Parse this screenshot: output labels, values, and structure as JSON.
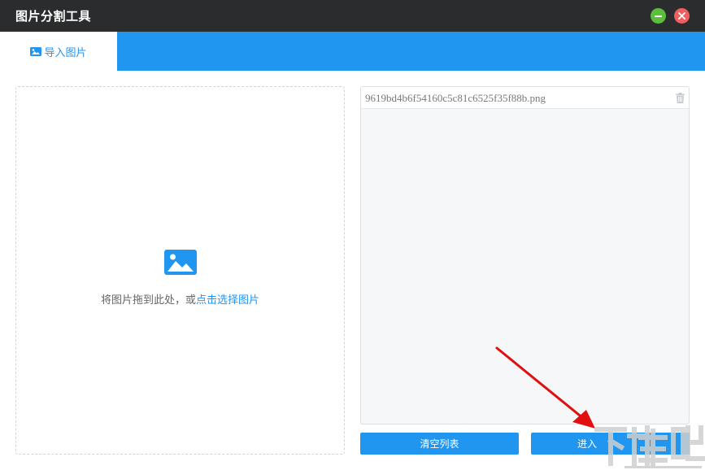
{
  "window": {
    "title": "图片分割工具",
    "minimize_icon": "minimize-icon",
    "close_icon": "close-icon"
  },
  "tabs": [
    {
      "label": "导入图片",
      "icon": "image-icon",
      "active": true
    }
  ],
  "dropzone": {
    "icon": "image-icon",
    "text": "将图片拖到此处，或",
    "link": "点击选择图片"
  },
  "file_list": {
    "items": [
      {
        "name": "9619bd4b6f54160c5c81c6525f35f88b.png",
        "delete_icon": "trash-icon"
      }
    ]
  },
  "buttons": {
    "clear_label": "清空列表",
    "enter_label": "进入"
  },
  "annotation": {
    "type": "arrow",
    "color": "#e01010"
  },
  "watermark": {
    "text": "下载吧"
  },
  "colors": {
    "accent": "#2196f0",
    "titlebar": "#2b2c2e",
    "minimize": "#5dbd3c",
    "close": "#f05e5e"
  }
}
